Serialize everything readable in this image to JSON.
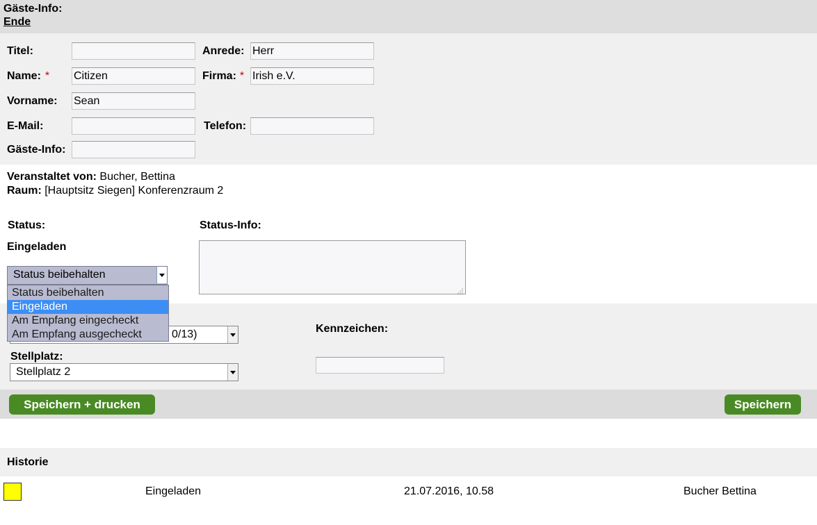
{
  "header": {
    "title": "Gäste-Info:",
    "end_link": "Ende"
  },
  "form": {
    "title_label": "Titel:",
    "title_value": "",
    "salutation_label": "Anrede:",
    "salutation_value": "Herr",
    "name_label": "Name:",
    "name_value": "Citizen",
    "company_label": "Firma:",
    "company_value": "Irish e.V.",
    "firstname_label": "Vorname:",
    "firstname_value": "Sean",
    "email_label": "E-Mail:",
    "email_value": "",
    "phone_label": "Telefon:",
    "phone_value": "",
    "guestinfo_label": "Gäste-Info:",
    "guestinfo_value": "",
    "required_marker": "*"
  },
  "info": {
    "host_label": "Veranstaltet von:",
    "host_value": "Bucher, Bettina",
    "room_label": "Raum:",
    "room_value": "[Hauptsitz Siegen] Konferenzraum 2"
  },
  "status": {
    "label": "Status:",
    "current": "Eingeladen",
    "info_label": "Status-Info:",
    "info_value": "",
    "select_value": "Status beibehalten",
    "options": [
      "Status beibehalten",
      "Eingeladen",
      "Am Empfang eingecheckt",
      "Am Empfang ausgecheckt"
    ],
    "highlighted_option": "Eingeladen"
  },
  "parking": {
    "partial_select_text": "0/13)",
    "space_label": "Stellplatz:",
    "space_value": "Stellplatz 2",
    "plate_label": "Kennzeichen:",
    "plate_value": ""
  },
  "actions": {
    "save_print": "Speichern + drucken",
    "save": "Speichern"
  },
  "history": {
    "title": "Historie",
    "rows": [
      {
        "color": "#ffff00",
        "status": "Eingeladen",
        "datetime": "21.07.2016, 10.58",
        "user": "Bucher Bettina"
      }
    ]
  },
  "colors": {
    "header_bg": "#dedede",
    "panel_bg": "#f0f0f0",
    "button_green": "#4a8a24",
    "dropdown_bg": "#b9bbd1",
    "dropdown_selected": "#3c8ef5"
  }
}
